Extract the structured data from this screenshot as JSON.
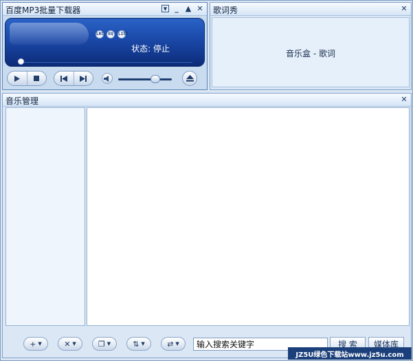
{
  "player": {
    "title": "百度MP3批量下载器",
    "window_buttons": [
      "▼",
      "_",
      "▲",
      "✕"
    ],
    "mini_buttons": [
      "LRC",
      "EQ",
      "LIST"
    ],
    "status_label": "状态:",
    "status_value": "停止",
    "progress": 0.0,
    "volume": 0.7
  },
  "lyrics": {
    "title": "歌词秀",
    "placeholder": "音乐盒 - 歌词",
    "close": "✕"
  },
  "manager": {
    "title": "音乐管理",
    "close": "✕",
    "toolbar": {
      "add": "+",
      "delete": "✕",
      "copy": "❐",
      "sort": "⇅",
      "loop": "⇄"
    },
    "search_placeholder": "输入搜索关键字",
    "search_button": "搜 索",
    "library_button": "媒体库"
  },
  "watermark": "JZ5U绿色下载站www.jz5u.com",
  "colors": {
    "screen": "#1a48a8",
    "panel": "#dbe7f4",
    "border": "#7fa0c9"
  }
}
